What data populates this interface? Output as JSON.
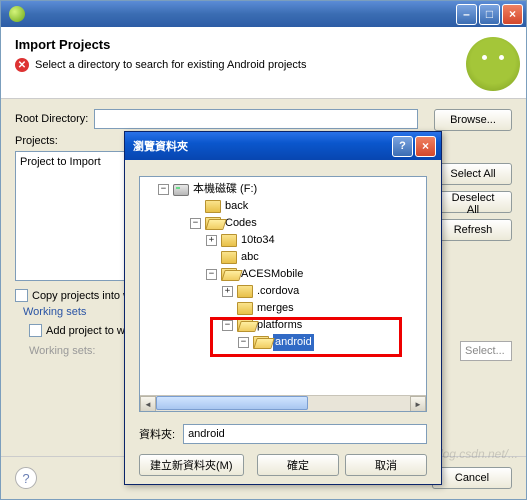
{
  "main": {
    "title": "Import Projects",
    "message": "Select a directory to search for existing Android projects",
    "root_dir_label": "Root Directory:",
    "root_dir_value": "",
    "browse_btn": "Browse...",
    "projects_label": "Projects:",
    "project_col": "Project to Import",
    "select_all": "Select All",
    "deselect_all": "Deselect All",
    "refresh": "Refresh",
    "copy_label": "Copy projects into workspace",
    "working_sets": "Working sets",
    "add_ws_label": "Add project to working sets",
    "ws_label": "Working sets:",
    "ws_select": "Select...",
    "cancel": "Cancel"
  },
  "browse": {
    "title": "瀏覽資料夾",
    "folder_label": "資料夾:",
    "folder_value": "android",
    "new_folder": "建立新資料夾(M)",
    "ok": "確定",
    "cancel": "取消",
    "tree": {
      "drive": "本機磁碟 (F:)",
      "back": "back",
      "codes": "Codes",
      "t10to34": "10to34",
      "abc": "abc",
      "aces": "ACESMobile",
      "cordova": ".cordova",
      "merges": "merges",
      "platforms": "platforms",
      "android": "android"
    }
  },
  "watermark": "http://blog.csdn.net/..."
}
